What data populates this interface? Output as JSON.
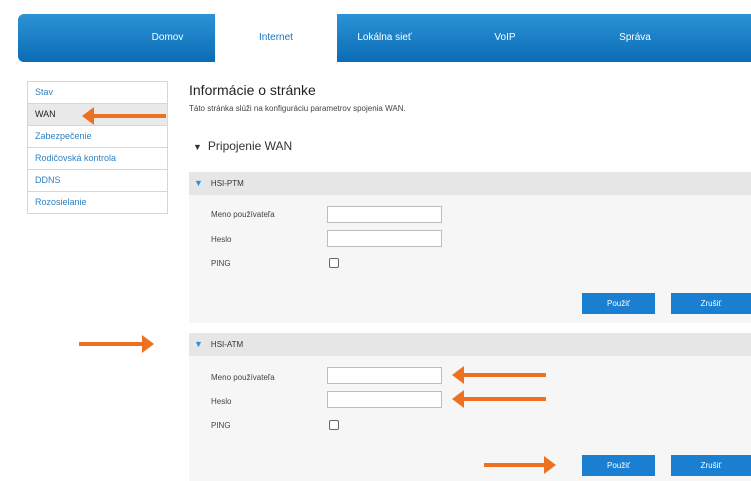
{
  "nav": {
    "items": [
      {
        "label": "Domov"
      },
      {
        "label": "Internet"
      },
      {
        "label": "Lokálna sieť"
      },
      {
        "label": "VoIP"
      },
      {
        "label": "Správa"
      }
    ],
    "active": "Internet"
  },
  "sidebar": {
    "items": [
      {
        "label": "Stav"
      },
      {
        "label": "WAN"
      },
      {
        "label": "Zabezpečenie"
      },
      {
        "label": "Rodičovská kontrola"
      },
      {
        "label": "DDNS"
      },
      {
        "label": "Rozosielanie"
      }
    ],
    "active": "WAN"
  },
  "page": {
    "title": "Informácie o stránke",
    "description": "Táto stránka slúži na konfiguráciu parametrov spojenia WAN."
  },
  "section": {
    "title": "Pripojenie WAN",
    "expand_icon": "triangle-down-icon"
  },
  "panels": [
    {
      "header": "HSI-PTM",
      "username_label": "Meno používateľa",
      "username_value": "",
      "password_label": "Heslo",
      "password_value": "",
      "ping_label": "PING",
      "ping_checked": false,
      "apply_label": "Použiť",
      "cancel_label": "Zrušiť"
    },
    {
      "header": "HSI-ATM",
      "username_label": "Meno používateľa",
      "username_value": "",
      "password_label": "Heslo",
      "password_value": "",
      "ping_label": "PING",
      "ping_checked": false,
      "apply_label": "Použiť",
      "cancel_label": "Zrušiť"
    }
  ],
  "colors": {
    "nav_blue": "#1a78c2",
    "button_blue": "#1a7fd0",
    "annotation_orange": "#ec7222",
    "link_blue": "#2f82c4"
  }
}
